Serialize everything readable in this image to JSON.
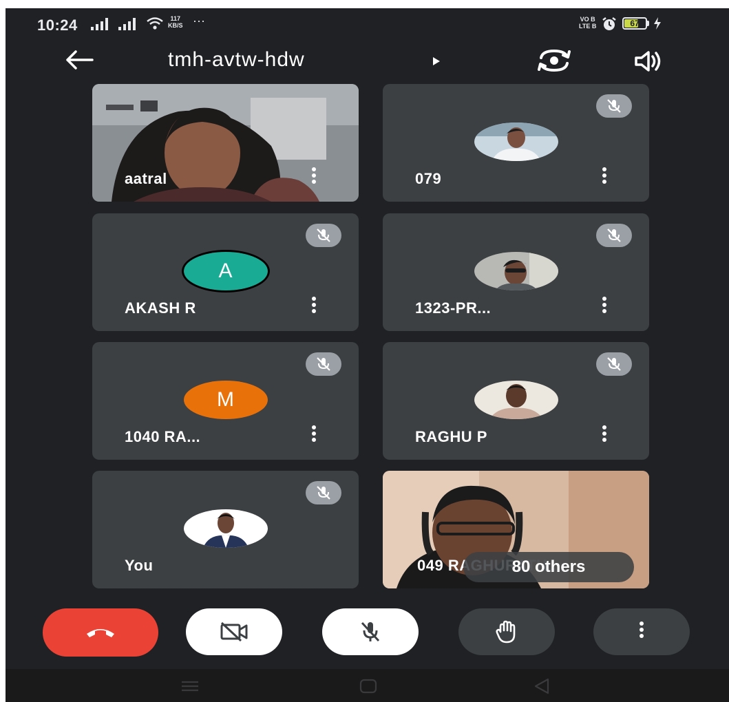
{
  "status_bar": {
    "time": "10:24",
    "net_speed_value": "117",
    "net_speed_unit": "KB/S",
    "dots": "···",
    "lte_top": "VO B",
    "lte_bottom": "LTE B",
    "battery_level": "67",
    "battery_fraction": 0.67,
    "icons": [
      "signal-icon",
      "wifi-icon",
      "alarm-icon",
      "charging-icon"
    ]
  },
  "top_bar": {
    "meeting_code": "tmh-avtw-hdw",
    "icons": [
      "back-arrow-icon",
      "switch-camera-icon",
      "speaker-icon"
    ]
  },
  "participants": [
    {
      "name": "aatral",
      "muted": false,
      "display": "video"
    },
    {
      "name": "079",
      "muted": true,
      "display": "photo-avatar"
    },
    {
      "name": "AKASH R",
      "muted": true,
      "display": "letter-avatar",
      "initial": "A",
      "color": "#1aab95"
    },
    {
      "name": "1323-PR...",
      "muted": true,
      "display": "photo-avatar"
    },
    {
      "name": "1040 RA...",
      "muted": true,
      "display": "letter-avatar",
      "initial": "M",
      "color": "#e8710a"
    },
    {
      "name": "RAGHU P",
      "muted": true,
      "display": "photo-avatar"
    },
    {
      "name": "You",
      "muted": true,
      "display": "photo-avatar"
    },
    {
      "name": "049 RAGHURATH...",
      "muted": false,
      "display": "video"
    }
  ],
  "others_pill": {
    "label": "80 others"
  },
  "controls": {
    "end_call_color": "#ea4335",
    "items": [
      "end-call-icon",
      "camera-off-icon",
      "mic-off-icon",
      "raise-hand-icon",
      "more-options-icon"
    ]
  },
  "colors": {
    "background": "#202124",
    "tile": "#3c4043",
    "mute_badge": "#9aa0a6"
  }
}
